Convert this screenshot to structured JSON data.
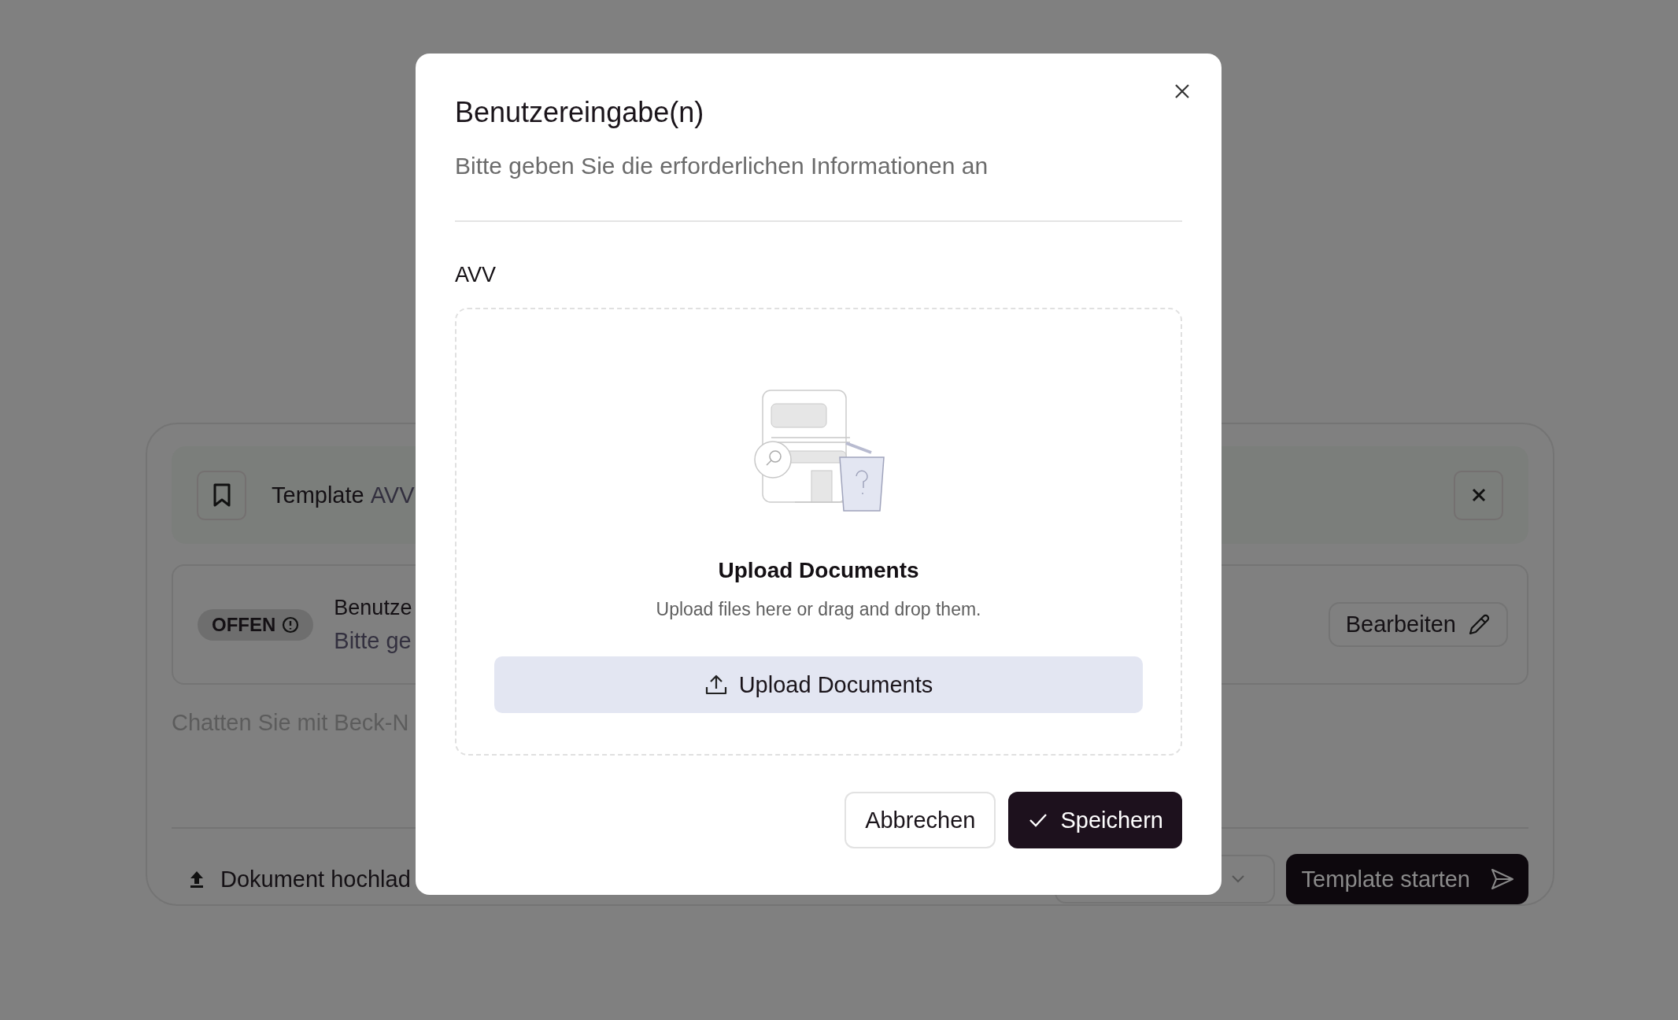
{
  "background": {
    "template_bar": {
      "label": "Template",
      "name": "AVV"
    },
    "task": {
      "status": "OFFEN",
      "title": "Benutze",
      "subtitle": "Bitte ge",
      "edit_button": "Bearbeiten"
    },
    "chat": {
      "placeholder": "Chatten Sie mit Beck-N"
    },
    "upload_button": "Dokument hochlad",
    "start_button": "Template starten"
  },
  "dialog": {
    "title": "Benutzereingabe(n)",
    "subtitle": "Bitte geben Sie die erforderlichen Informationen an",
    "field_label": "AVV",
    "dropzone": {
      "heading": "Upload Documents",
      "hint": "Upload files here or drag and drop them.",
      "button": "Upload Documents"
    },
    "buttons": [
      {
        "label": "Abbrechen",
        "kind": "secondary"
      },
      {
        "label": "Speichern",
        "kind": "primary"
      }
    ]
  }
}
